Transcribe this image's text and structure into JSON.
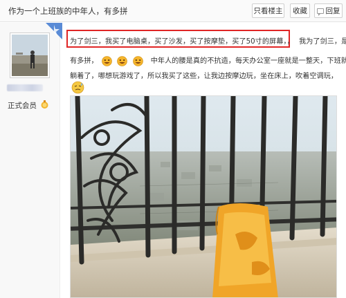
{
  "header": {
    "title": "作为一个上班族的中年人，有多拼",
    "buttons": {
      "only_op": "只看楼主",
      "favorite": "收藏",
      "reply": "回复"
    }
  },
  "user": {
    "rank": "正式会员"
  },
  "post": {
    "highlighted_text": "为了剑三，我买了电脑桌，买了沙发，买了按摩垫，买了50寸的屏幕，，",
    "line1_tail": "我为了剑三，是",
    "line2_start": "有多拼，",
    "line2_end": "中年人的腰是真的不抗造，每天办公室一座就是一整天，下班就想",
    "line3": "躺着了，哪想玩游戏了，所以我买了这些，让我边按摩边玩，坐在床上，吹着空调玩，"
  },
  "colors": {
    "highlight_border": "#e02525",
    "emoji_face": "#f5b52c"
  }
}
